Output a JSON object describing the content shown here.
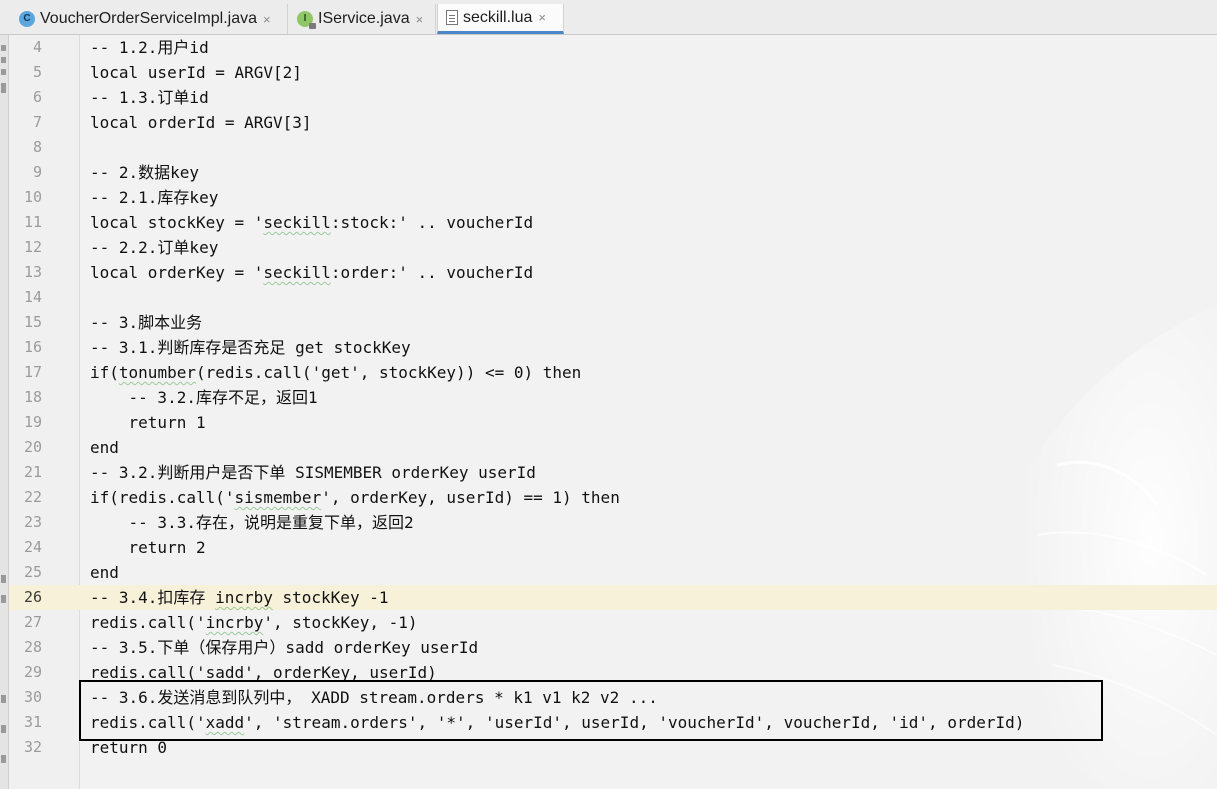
{
  "tabs": [
    {
      "label": "VoucherOrderServiceImpl.java",
      "icon": "java-class-icon",
      "active": false
    },
    {
      "label": "IService.java",
      "icon": "java-interface-icon",
      "active": false
    },
    {
      "label": "seckill.lua",
      "icon": "lua-file-icon",
      "active": true
    }
  ],
  "close_glyph": "×",
  "current_line": 26,
  "code": {
    "lines": [
      {
        "n": "4",
        "text": "-- 1.2.用户id"
      },
      {
        "n": "5",
        "text": "local userId = ARGV[2]"
      },
      {
        "n": "6",
        "text": "-- 1.3.订单id"
      },
      {
        "n": "7",
        "text": "local orderId = ARGV[3]"
      },
      {
        "n": "8",
        "text": ""
      },
      {
        "n": "9",
        "text": "-- 2.数据key"
      },
      {
        "n": "10",
        "text": "-- 2.1.库存key"
      },
      {
        "n": "11",
        "text": "local stockKey = 'seckill:stock:' .. voucherId"
      },
      {
        "n": "12",
        "text": "-- 2.2.订单key"
      },
      {
        "n": "13",
        "text": "local orderKey = 'seckill:order:' .. voucherId"
      },
      {
        "n": "14",
        "text": ""
      },
      {
        "n": "15",
        "text": "-- 3.脚本业务"
      },
      {
        "n": "16",
        "text": "-- 3.1.判断库存是否充足 get stockKey"
      },
      {
        "n": "17",
        "text": "if(tonumber(redis.call('get', stockKey)) <= 0) then"
      },
      {
        "n": "18",
        "text": "    -- 3.2.库存不足，返回1"
      },
      {
        "n": "19",
        "text": "    return 1"
      },
      {
        "n": "20",
        "text": "end"
      },
      {
        "n": "21",
        "text": "-- 3.2.判断用户是否下单 SISMEMBER orderKey userId"
      },
      {
        "n": "22",
        "text": "if(redis.call('sismember', orderKey, userId) == 1) then"
      },
      {
        "n": "23",
        "text": "    -- 3.3.存在，说明是重复下单，返回2"
      },
      {
        "n": "24",
        "text": "    return 2"
      },
      {
        "n": "25",
        "text": "end"
      },
      {
        "n": "26",
        "text": "-- 3.4.扣库存 incrby stockKey -1"
      },
      {
        "n": "27",
        "text": "redis.call('incrby', stockKey, -1)"
      },
      {
        "n": "28",
        "text": "-- 3.5.下单（保存用户）sadd orderKey userId"
      },
      {
        "n": "29",
        "text": "redis.call('sadd', orderKey, userId)"
      },
      {
        "n": "30",
        "text": "-- 3.6.发送消息到队列中， XADD stream.orders * k1 v1 k2 v2 ..."
      },
      {
        "n": "31",
        "text": "redis.call('xadd', 'stream.orders', '*', 'userId', userId, 'voucherId', voucherId, 'id', orderId)"
      },
      {
        "n": "32",
        "text": "return 0"
      }
    ]
  },
  "highlight": {
    "lines": [
      "30",
      "31"
    ],
    "color": "#000000"
  },
  "colors": {
    "editor_bg": "#f2f2f2",
    "current_line_bg": "#f7f1d9",
    "active_tab_underline": "#4a87c9",
    "line_number": "#9b9b9b"
  }
}
